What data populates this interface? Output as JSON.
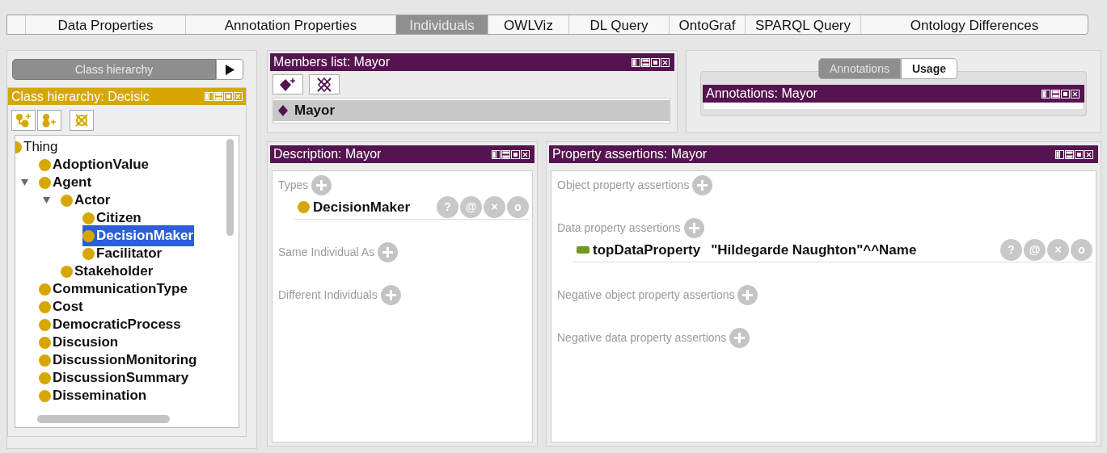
{
  "tabs": [
    {
      "label": "Data Properties",
      "selected": false
    },
    {
      "label": "Annotation Properties",
      "selected": false
    },
    {
      "label": "Individuals",
      "selected": true
    },
    {
      "label": "OWLViz",
      "selected": false
    },
    {
      "label": "DL Query",
      "selected": false
    },
    {
      "label": "OntoGraf",
      "selected": false
    },
    {
      "label": "SPARQL Query",
      "selected": false
    },
    {
      "label": "Ontology Differences",
      "selected": false
    }
  ],
  "class_hierarchy": {
    "toggle": "Class hierarchy",
    "title": "Class hierarchy: Decisic",
    "tree": [
      {
        "label": "Thing",
        "selected": false,
        "children": [
          {
            "label": "AdoptionValue",
            "selected": false
          },
          {
            "label": "Agent",
            "selected": false,
            "expanded": true,
            "children": [
              {
                "label": "Actor",
                "selected": false,
                "expanded": true,
                "children": [
                  {
                    "label": "Citizen",
                    "selected": false
                  },
                  {
                    "label": "DecisionMaker",
                    "selected": true
                  },
                  {
                    "label": "Facilitator",
                    "selected": false
                  }
                ]
              },
              {
                "label": "Stakeholder",
                "selected": false
              }
            ]
          },
          {
            "label": "CommunicationType",
            "selected": false
          },
          {
            "label": "Cost",
            "selected": false
          },
          {
            "label": "DemocraticProcess",
            "selected": false
          },
          {
            "label": "Discusion",
            "selected": false
          },
          {
            "label": "DiscussionMonitoring",
            "selected": false
          },
          {
            "label": "DiscussionSummary",
            "selected": false
          },
          {
            "label": "Dissemination",
            "selected": false
          }
        ]
      }
    ]
  },
  "members_list": {
    "title": "Members list: Mayor",
    "items": [
      {
        "label": "Mayor",
        "selected": true
      }
    ]
  },
  "annotations_panel": {
    "tabs": [
      {
        "label": "Annotations",
        "selected": true
      },
      {
        "label": "Usage",
        "selected": false
      }
    ],
    "title": "Annotations: Mayor"
  },
  "description": {
    "title": "Description: Mayor",
    "sections": [
      {
        "label": "Types",
        "entries": [
          {
            "kind": "class",
            "label": "DecisionMaker",
            "actions": [
              "?",
              "@",
              "×",
              "o"
            ]
          }
        ]
      },
      {
        "label": "Same Individual As"
      },
      {
        "label": "Different Individuals"
      }
    ]
  },
  "property_assertions": {
    "title": "Property assertions: Mayor",
    "sections": [
      {
        "label": "Object property assertions"
      },
      {
        "label": "Data property assertions",
        "entries": [
          {
            "kind": "data_property",
            "label": "topDataProperty",
            "value": "\"Hildegarde Naughton\"^^Name",
            "actions": [
              "?",
              "@",
              "×",
              "o"
            ]
          }
        ]
      },
      {
        "label": "Negative object property assertions"
      },
      {
        "label": "Negative data property assertions"
      }
    ]
  }
}
